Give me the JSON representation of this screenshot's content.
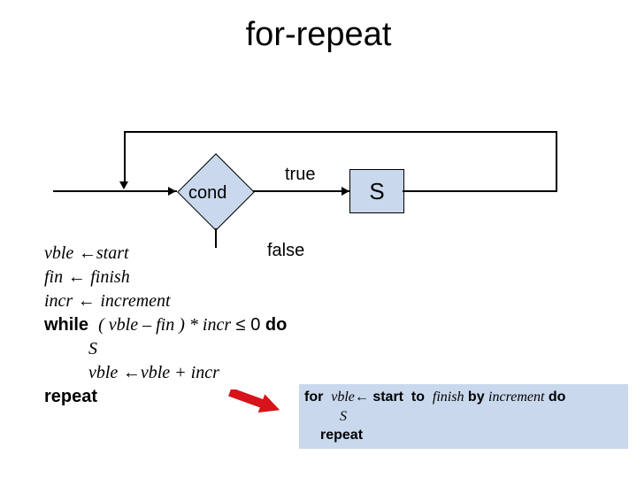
{
  "title": "for-repeat",
  "flow": {
    "cond_label": "cond",
    "true_label": "true",
    "false_label": "false",
    "s_label": "S"
  },
  "pseudo": {
    "l1_vble": "vble",
    "l1_arrow": "←",
    "l1_start": "start",
    "l2_fin": "fin",
    "l2_arrow": "←",
    "l2_finish": "finish",
    "l3_incr": "incr",
    "l3_arrow": "←",
    "l3_increment": "increment",
    "l4_while": "while",
    "l4_expr_a": "( vble – fin ) * incr",
    "l4_le": "≤",
    "l4_zero": "0",
    "l4_do": "do",
    "l5_S": "S",
    "l6_vble": "vble",
    "l6_arrow": "←",
    "l6_rhs": "vble + incr",
    "l7_repeat": "repeat"
  },
  "forbox": {
    "for": "for",
    "vble": "vble",
    "arrow": "←",
    "start": "start",
    "to": "to",
    "finish": "finish",
    "by": "by",
    "increment": "increment",
    "do": "do",
    "S": "S",
    "repeat": "repeat"
  },
  "icons": {
    "red_arrow": "red-arrow-icon"
  }
}
